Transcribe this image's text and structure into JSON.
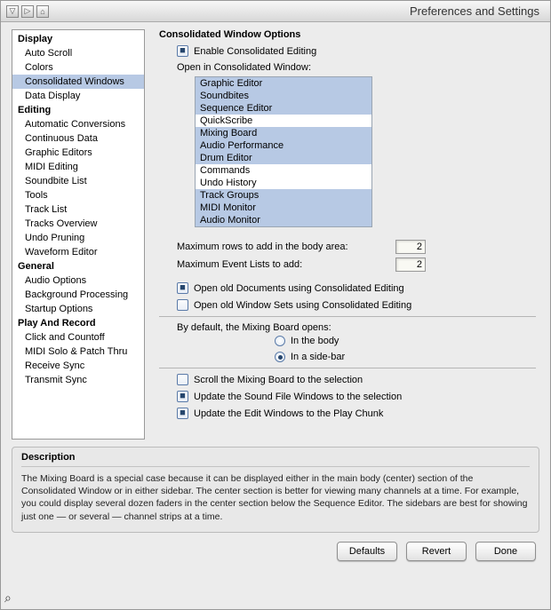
{
  "window": {
    "title": "Preferences and Settings"
  },
  "sidebar": {
    "categories": [
      {
        "name": "Display",
        "items": [
          "Auto Scroll",
          "Colors",
          "Consolidated Windows",
          "Data Display"
        ],
        "selected_index": 2
      },
      {
        "name": "Editing",
        "items": [
          "Automatic Conversions",
          "Continuous Data",
          "Graphic Editors",
          "MIDI Editing",
          "Soundbite List",
          "Tools",
          "Track List",
          "Tracks Overview",
          "Undo Pruning",
          "Waveform Editor"
        ]
      },
      {
        "name": "General",
        "items": [
          "Audio Options",
          "Background Processing",
          "Startup Options"
        ]
      },
      {
        "name": "Play And Record",
        "items": [
          "Click and Countoff",
          "MIDI Solo & Patch Thru",
          "Receive Sync",
          "Transmit Sync"
        ]
      }
    ]
  },
  "panel": {
    "heading": "Consolidated Window Options",
    "enable_label": "Enable Consolidated Editing",
    "enable_checked": true,
    "open_label": "Open in Consolidated Window:",
    "open_list": [
      {
        "label": "Graphic Editor",
        "selected": true
      },
      {
        "label": "Soundbites",
        "selected": true
      },
      {
        "label": "Sequence Editor",
        "selected": true
      },
      {
        "label": "QuickScribe",
        "selected": false
      },
      {
        "label": "Mixing Board",
        "selected": true
      },
      {
        "label": "Audio Performance",
        "selected": true
      },
      {
        "label": "Drum Editor",
        "selected": true
      },
      {
        "label": "Commands",
        "selected": false
      },
      {
        "label": "Undo History",
        "selected": false
      },
      {
        "label": "Track Groups",
        "selected": true
      },
      {
        "label": "MIDI Monitor",
        "selected": true
      },
      {
        "label": "Audio Monitor",
        "selected": true
      }
    ],
    "max_rows_label": "Maximum rows to add in the body area:",
    "max_rows_value": "2",
    "max_lists_label": "Maximum Event Lists to add:",
    "max_lists_value": "2",
    "old_docs_label": "Open old Documents using Consolidated Editing",
    "old_docs_checked": true,
    "old_sets_label": "Open old Window Sets using Consolidated Editing",
    "old_sets_checked": false,
    "mix_default_label": "By default, the Mixing Board opens:",
    "mix_body_label": "In the body",
    "mix_sidebar_label": "In a side-bar",
    "mix_selected": "sidebar",
    "scroll_mix_label": "Scroll the Mixing Board to the selection",
    "scroll_mix_checked": false,
    "update_sf_label": "Update the Sound File Windows to the selection",
    "update_sf_checked": true,
    "update_edit_label": "Update the Edit Windows to the Play Chunk",
    "update_edit_checked": true
  },
  "description": {
    "title": "Description",
    "text": "The Mixing Board is a special case because it can be displayed either in the main body (center) section of the Consolidated Window or in either sidebar. The center section is better for viewing many channels at a time. For example, you could display several dozen faders in the center section below the Sequence Editor. The sidebars are best for showing just one — or several — channel strips at a time."
  },
  "buttons": {
    "defaults": "Defaults",
    "revert": "Revert",
    "done": "Done"
  }
}
